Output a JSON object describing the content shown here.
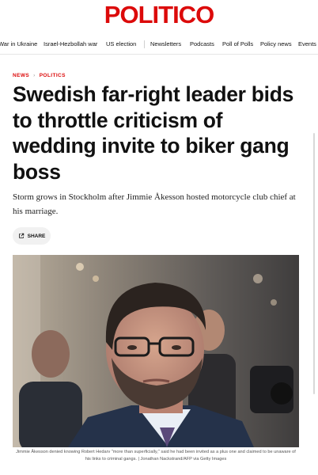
{
  "brand": {
    "logo_text": "POLITICO",
    "color": "#dc0a0a"
  },
  "nav": {
    "items": [
      "War in Ukraine",
      "Israel-Hezbollah war",
      "US election",
      "Newsletters",
      "Podcasts",
      "Poll of Polls",
      "Policy news",
      "Events"
    ]
  },
  "breadcrumb": {
    "section": "NEWS",
    "subsection": "POLITICS"
  },
  "article": {
    "headline": "Swedish far-right leader bids to throttle criticism of wedding invite to biker gang boss",
    "dek": "Storm grows in Stockholm after Jimmie Åkesson hosted motorcycle club chief at his marriage.",
    "share_label": "SHARE",
    "photo_caption": "Jimmie Åkesson denied knowing Robert Hedarv \"more than superficially,\" said he had been invited as a plus one and claimed to be unaware of his links to criminal gangs. | Jonathan Nackstrand/AFP via Getty Images"
  },
  "icons": {
    "share": "share-icon"
  }
}
